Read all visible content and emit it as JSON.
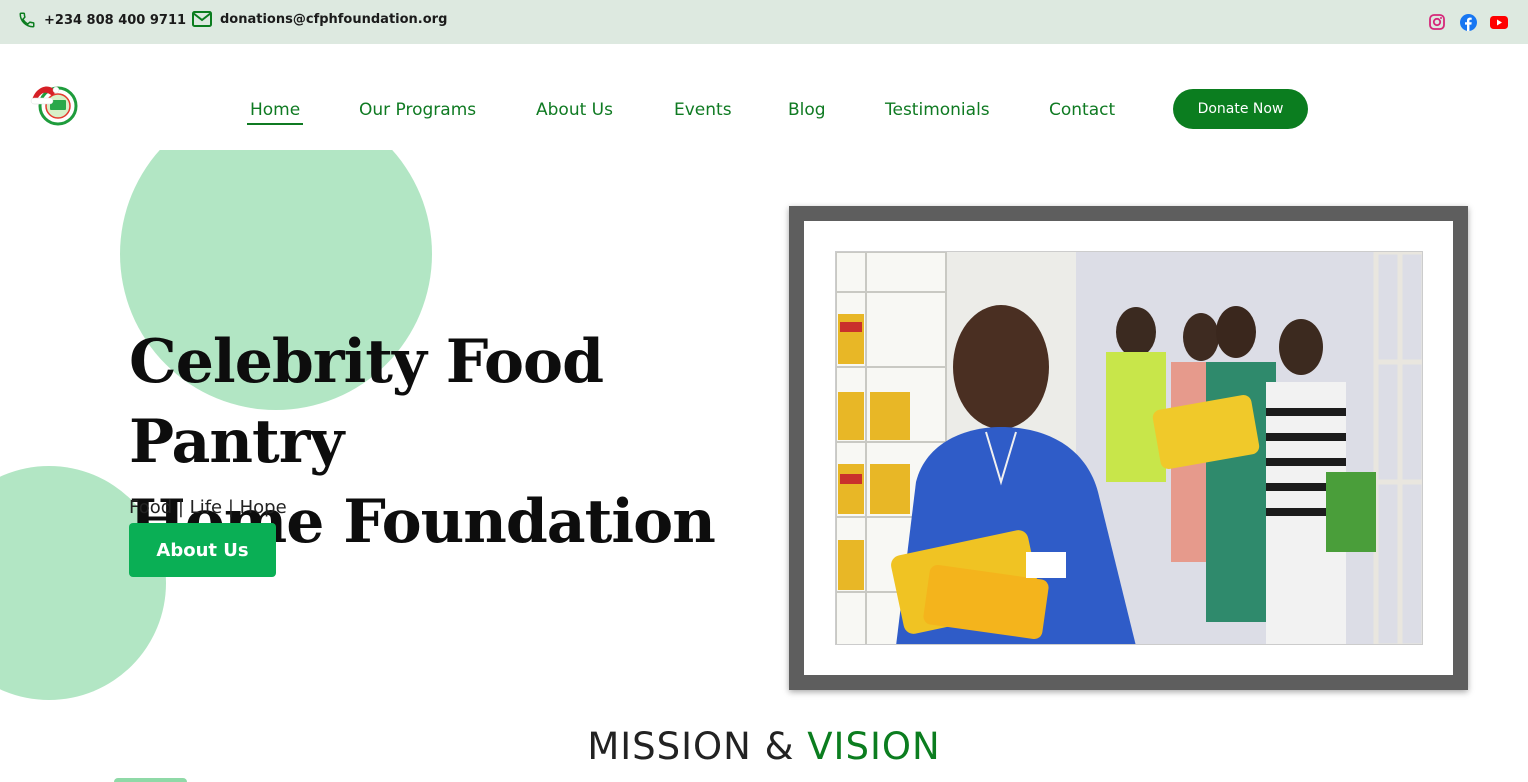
{
  "topbar": {
    "phone": "+234 808 400 9711",
    "email": "donations@cfphfoundation.org",
    "social": [
      "instagram-icon",
      "facebook-icon",
      "youtube-icon"
    ]
  },
  "nav": {
    "items": [
      "Home",
      "Our Programs",
      "About Us",
      "Events",
      "Blog",
      "Testimonials",
      "Contact"
    ],
    "active": "Home",
    "donate_label": "Donate Now"
  },
  "hero": {
    "title_line1": "Celebrity Food Pantry",
    "title_line2": "Home Foundation",
    "tagline": "Food | Life | Hope",
    "button_label": "About Us"
  },
  "mission": {
    "word1": "MISSION &",
    "word2": "VISION"
  },
  "colors": {
    "brand_green": "#0b7d1f",
    "button_green": "#0aaf55",
    "circle_green": "#b2e6c4",
    "topbar_bg": "#dde9e0"
  }
}
